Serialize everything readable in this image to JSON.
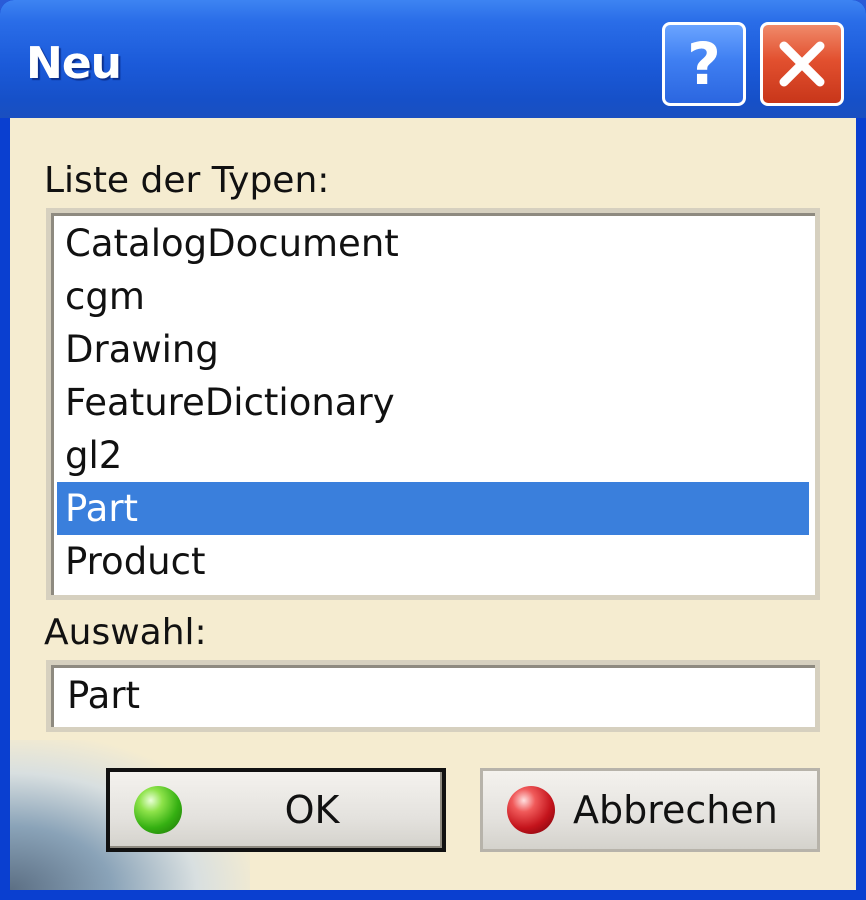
{
  "window": {
    "title": "Neu",
    "help_glyph": "?",
    "colors": {
      "titlebar": "#1b5ad9",
      "client_background": "#f5ecd0",
      "selection": "#3a7fdc",
      "close_button": "#e2502f"
    }
  },
  "types_label": "Liste der Typen:",
  "types_list": {
    "items": [
      {
        "label": "CatalogDocument",
        "selected": false
      },
      {
        "label": "cgm",
        "selected": false
      },
      {
        "label": "Drawing",
        "selected": false
      },
      {
        "label": "FeatureDictionary",
        "selected": false
      },
      {
        "label": "gl2",
        "selected": false
      },
      {
        "label": "Part",
        "selected": true
      },
      {
        "label": "Product",
        "selected": false
      }
    ]
  },
  "selection_label": "Auswahl:",
  "selection_value": "Part",
  "buttons": {
    "ok_label": "OK",
    "ok_icon": "green-orb-icon",
    "cancel_label": "Abbrechen",
    "cancel_icon": "red-orb-icon"
  }
}
